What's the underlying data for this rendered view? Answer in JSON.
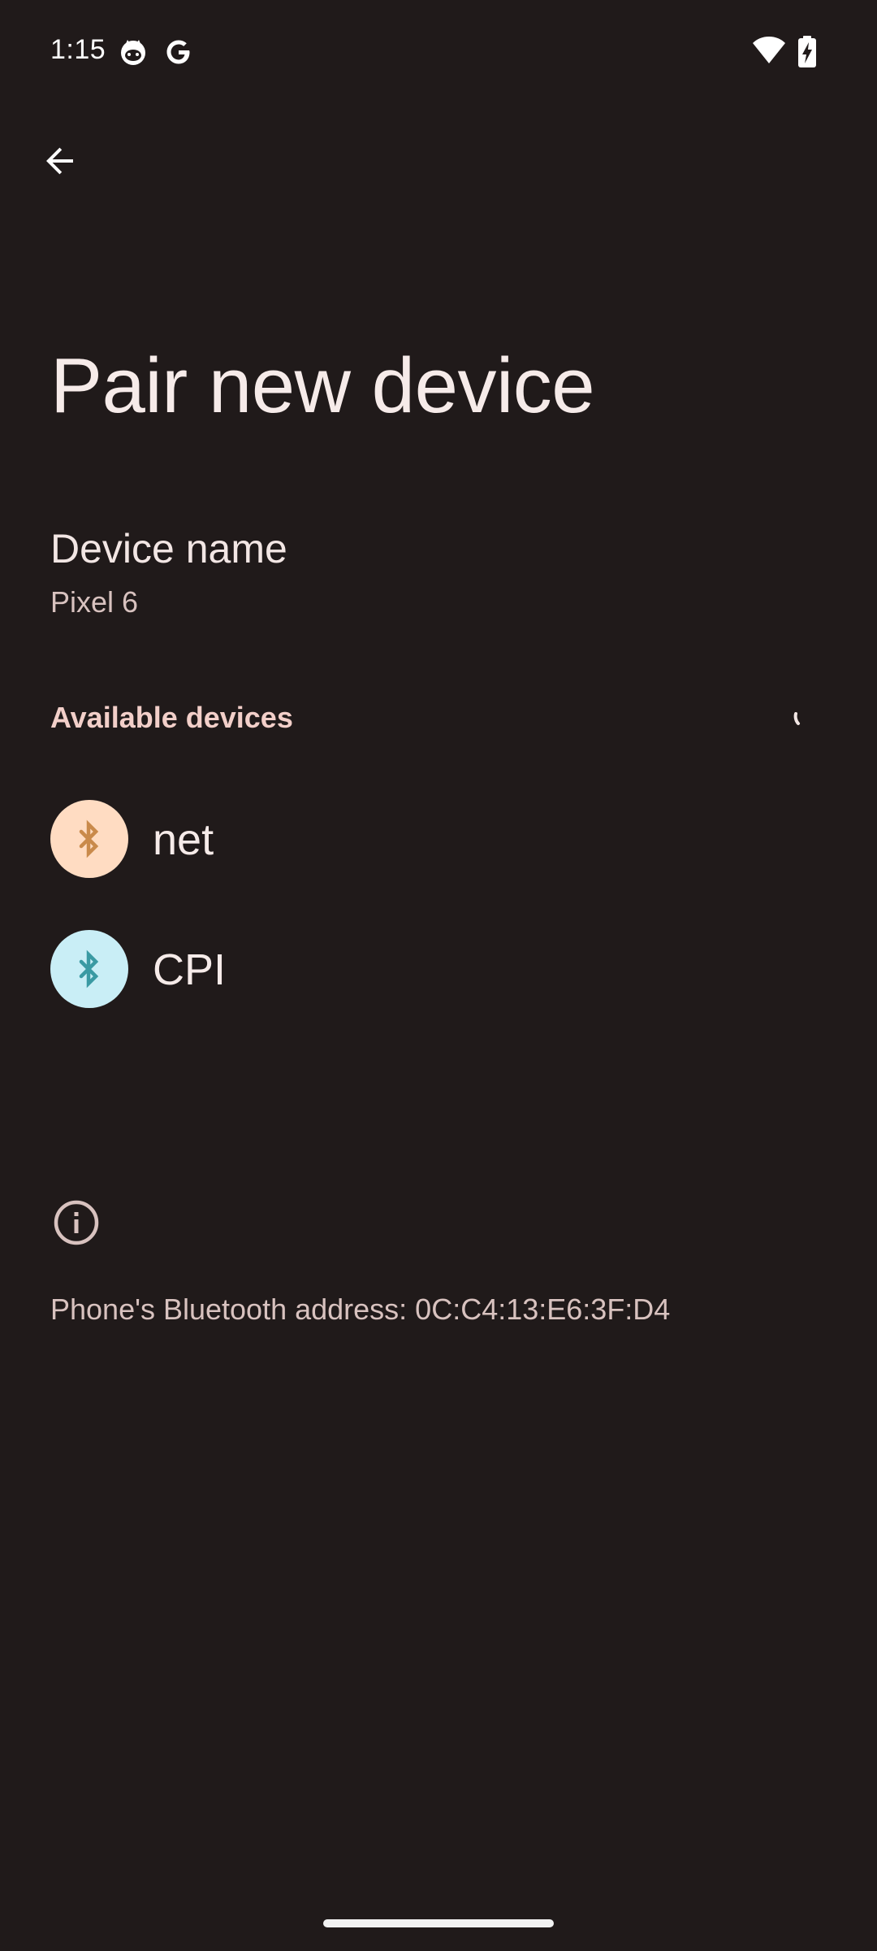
{
  "status_bar": {
    "time": "1:15",
    "left_icons": [
      "cat-face-icon",
      "google-g-icon"
    ],
    "right_icons": [
      "wifi-icon",
      "battery-charging-icon"
    ]
  },
  "toolbar": {
    "back_icon": "back-arrow-icon"
  },
  "page": {
    "title": "Pair new device"
  },
  "device_name": {
    "title": "Device name",
    "value": "Pixel 6"
  },
  "available_devices": {
    "header": "Available devices",
    "devices": [
      {
        "label": "net",
        "icon": "bluetooth-icon",
        "icon_bg": "#ffdcc2",
        "icon_fg": "#c98a4b"
      },
      {
        "label": "CPI",
        "icon": "bluetooth-icon",
        "icon_bg": "#c9eef6",
        "icon_fg": "#3a9aa3"
      }
    ]
  },
  "footer": {
    "info_icon": "info-icon",
    "bluetooth_address": "Phone's Bluetooth address: 0C:C4:13:E6:3F:D4"
  },
  "colors": {
    "background": "#201a1a",
    "title_text": "#f6ebe9",
    "secondary_text": "#d8c2bf",
    "accent_header": "#f2cfc9"
  }
}
